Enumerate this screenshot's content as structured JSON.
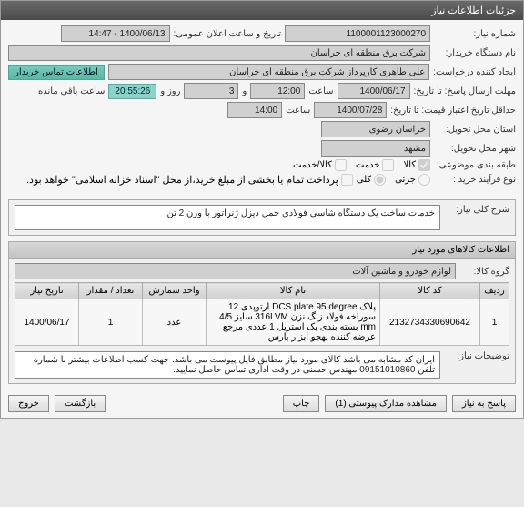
{
  "panel": {
    "title": "جزئیات اطلاعات نیاز"
  },
  "form": {
    "need_no_label": "شماره نیاز:",
    "need_no": "1100001123000270",
    "announce_label": "تاریخ و ساعت اعلان عمومی:",
    "announce_value": "1400/06/13 - 14:47",
    "org_label": "نام دستگاه خریدار:",
    "org_value": "شرکت برق منطقه ای خراسان",
    "requester_label": "ایجاد کننده درخواست:",
    "requester_value": "علی طاهری کارپرداز شرکت برق منطقه ای خراسان",
    "contact_btn": "اطلاعات تماس خریدار",
    "deadline_label": "مهلت ارسال پاسخ: تا تاریخ:",
    "deadline_date": "1400/06/17",
    "hour_label": "ساعت",
    "deadline_hour": "12:00",
    "and_label": "و",
    "days_value": "3",
    "days_label": "روز و",
    "timer": "20:55:26",
    "remain_label": "ساعت باقی مانده",
    "validity_label": "حداقل تاریخ اعتبار قیمت: تا تاریخ:",
    "validity_date": "1400/07/28",
    "validity_hour": "14:00",
    "province_label": "استان محل تحویل:",
    "province_value": "خراسان رضوی",
    "city_label": "شهر محل تحویل:",
    "city_value": "مشهد",
    "category_label": "طبقه بندی موضوعی:",
    "category_opts": {
      "goods": "کالا",
      "service": "خدمت",
      "goods_service": "کالا/خدمت"
    },
    "buy_process_label": "نوع فرآیند خرید :",
    "buy_opts": {
      "partial": "جزئی",
      "full": "کلی"
    },
    "buy_note": "پرداخت تمام یا بخشی از مبلغ خرید،از محل \"اسناد خزانه اسلامی\" خواهد بود."
  },
  "desc_section": {
    "title": "شرح کلی نیاز:",
    "text": "خدمات ساخت یک دستگاه شاسی فولادی حمل دیزل ژنراتور با وزن 2 تن"
  },
  "items_section": {
    "title": "اطلاعات کالاهای مورد نیاز",
    "group_label": "گروه کالا:",
    "group_value": "لوازم خودرو و ماشین آلات",
    "headers": {
      "row": "ردیف",
      "code": "کد کالا",
      "name": "نام کالا",
      "unit": "واحد شمارش",
      "qty": "تعداد / مقدار",
      "date": "تاریخ نیاز"
    },
    "rows": [
      {
        "idx": "1",
        "code": "2132734330690642",
        "name": "پلاک DCS plate 95 degree ارتوپدی 12 سوراخه فولاد زنگ نزن 316LVM سایز 4/5 mm بسته بندی بک استریل 1 عددی مرجع عرضه کننده بهجو ابزار پارس",
        "unit": "عدد",
        "qty": "1",
        "date": "1400/06/17"
      }
    ],
    "notes_label": "توضیحات نیاز:",
    "notes_value": "ایران کد مشابه می باشد کالای مورد نیاز مطابق فایل پیوست می باشد. جهت کسب اطلاعات بیشتر با شماره تلفن 09151010860 مهندس حسنی در وقت اداری تماس حاصل نمایید."
  },
  "buttons": {
    "respond": "پاسخ به نیاز",
    "attachments": "مشاهده مدارک پیوستی (1)",
    "print": "چاپ",
    "back": "بازگشت",
    "exit": "خروج"
  }
}
